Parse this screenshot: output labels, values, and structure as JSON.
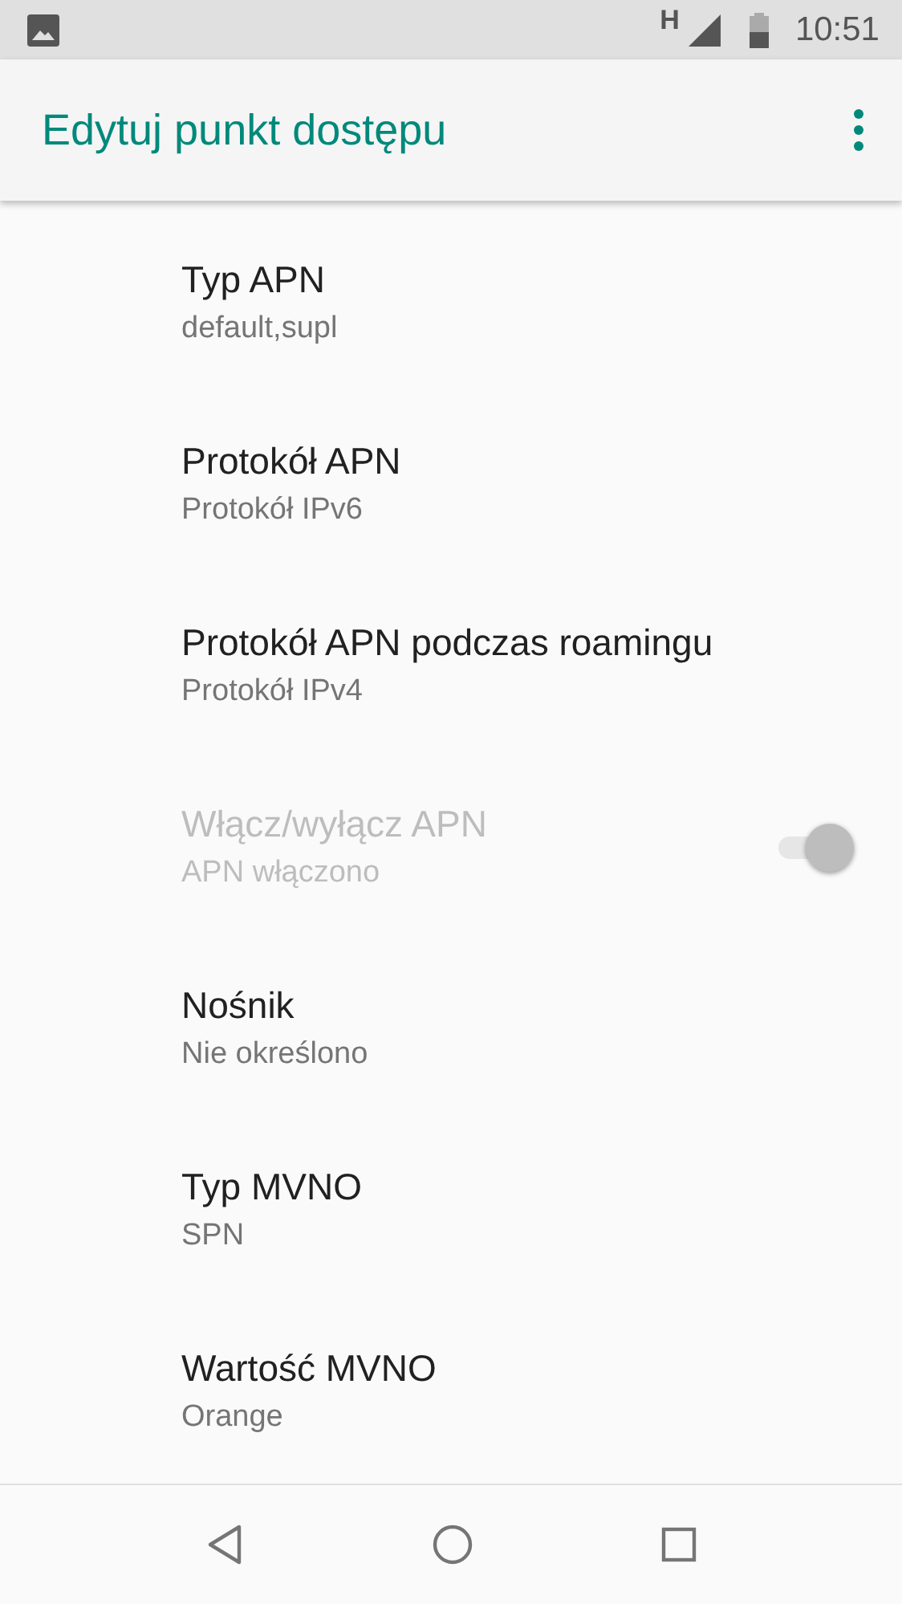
{
  "status_bar": {
    "network": "H",
    "time": "10:51"
  },
  "app_bar": {
    "title": "Edytuj punkt dostępu"
  },
  "items": [
    {
      "kind": "text",
      "title": "Typ APN",
      "summary": "default,supl",
      "disabled": false
    },
    {
      "kind": "text",
      "title": "Protokół APN",
      "summary": "Protokół IPv6",
      "disabled": false
    },
    {
      "kind": "text",
      "title": "Protokół APN podczas roamingu",
      "summary": "Protokół IPv4",
      "disabled": false
    },
    {
      "kind": "switch",
      "title": "Włącz/wyłącz APN",
      "summary": "APN włączono",
      "disabled": true,
      "checked": true
    },
    {
      "kind": "text",
      "title": "Nośnik",
      "summary": "Nie określono",
      "disabled": false
    },
    {
      "kind": "text",
      "title": "Typ MVNO",
      "summary": "SPN",
      "disabled": false
    },
    {
      "kind": "text",
      "title": "Wartość MVNO",
      "summary": "Orange",
      "disabled": false
    }
  ]
}
